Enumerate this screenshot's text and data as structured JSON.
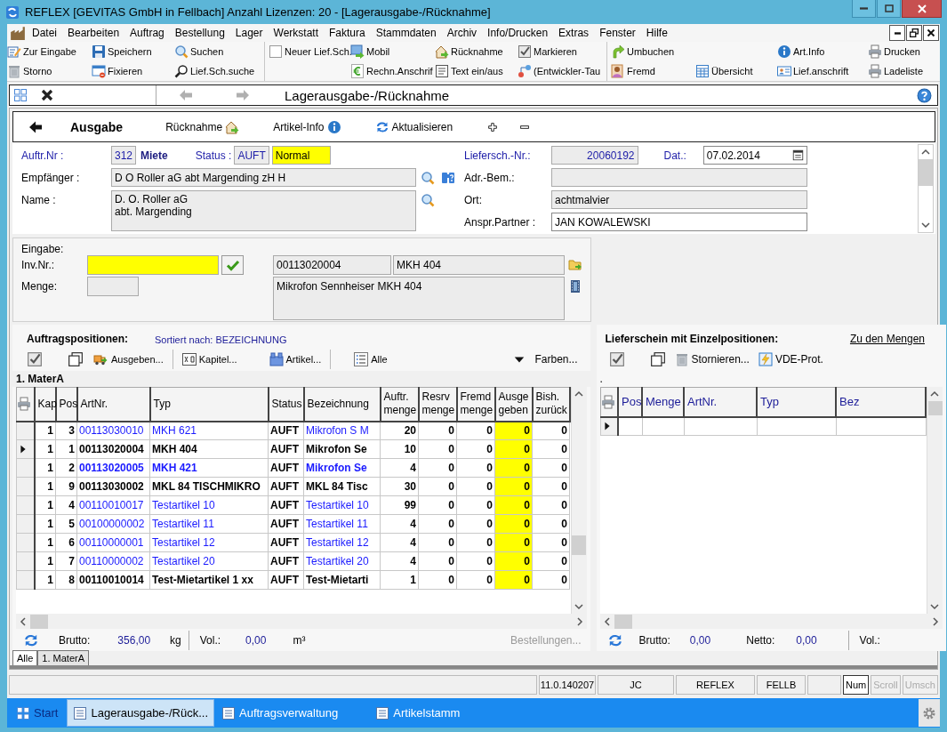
{
  "window": {
    "title": "REFLEX [GEVITAS GmbH in Fellbach] Anzahl Lizenzen: 20 - [Lagerausgabe-/Rücknahme]"
  },
  "menu": [
    "Datei",
    "Bearbeiten",
    "Auftrag",
    "Bestellung",
    "Lager",
    "Werkstatt",
    "Faktura",
    "Stammdaten",
    "Archiv",
    "Info/Drucken",
    "Extras",
    "Fenster",
    "Hilfe"
  ],
  "toolbar": {
    "groups": [
      {
        "columns": [
          {
            "top": "Zur Eingabe",
            "bottom": "Storno"
          },
          {
            "top": "Speichern",
            "bottom": "Fixieren"
          },
          {
            "top": "Suchen",
            "bottom": "Lief.Sch.suche"
          }
        ]
      },
      {
        "columns": [
          {
            "top": "Neuer Lief.Sch."
          },
          {
            "top": "Mobil",
            "bottom": "Rechn.Anschrif"
          },
          {
            "top": "Rücknahme",
            "bottom": "Text ein/aus"
          },
          {
            "top": "Markieren",
            "bottom": "(Entwickler-Tau"
          }
        ]
      },
      {
        "columns": [
          {
            "top": "Umbuchen",
            "bottom": "Fremd"
          },
          {
            "bottom": "Übersicht"
          },
          {
            "top": "Art.Info",
            "bottom": "Lief.anschrift"
          },
          {
            "top": "Drucken",
            "bottom": "Ladeliste"
          }
        ]
      }
    ]
  },
  "document_tab": {
    "title": "Lagerausgabe-/Rücknahme",
    "back": {
      "disabled": true
    },
    "forward": {
      "disabled": true
    }
  },
  "actions": {
    "mode": "Ausgabe",
    "items": [
      "Rücknahme",
      "Artikel-Info",
      "Aktualisieren"
    ]
  },
  "header": {
    "auftr_nr": {
      "label": "Auftr.Nr :",
      "value": {
        "text": "312",
        "color": "#1c1ca8"
      },
      "color": "#1c1ca8",
      "editable": false
    },
    "auftrag_art": "Miete",
    "status": {
      "label": "Status :",
      "value": {
        "text": "AUFT",
        "color": "#1c1ca8"
      },
      "color": "#1c1ca8",
      "editable": false
    },
    "priority": {
      "value": "Normal",
      "highlighted": true
    },
    "empfaenger": {
      "label": "Empfänger :",
      "value": "D O Roller aG abt Margending zH H",
      "color": "#000000",
      "editable": false
    },
    "name": {
      "label": "Name :",
      "value": "D. O. Roller aG\nabt. Margending",
      "color": "#000000",
      "editable": false
    },
    "lieferschein_nr": {
      "label": "Liefersch.-Nr.:",
      "value": {
        "text": "20060192",
        "color": "#1c1ca8"
      },
      "color": "#1c1ca8",
      "editable": false
    },
    "datum": {
      "label": "Dat.:",
      "value": "07.02.2014",
      "color": "#1c1ca8",
      "editable": true
    },
    "adr_bem": {
      "label": "Adr.-Bem.:",
      "color": "#000000",
      "editable": false
    },
    "ort": {
      "label": "Ort:",
      "value": "achtmalvier",
      "color": "#000000",
      "editable": false
    },
    "ansprechpartner": {
      "label": "Anspr.Partner :",
      "value": "JAN KOWALEWSKI",
      "color": "#000000",
      "editable": true
    }
  },
  "eingabe": {
    "title": "Eingabe:",
    "inv_nr": {
      "label": "Inv.Nr.:",
      "highlighted": true
    },
    "menge": {
      "label": "Menge:",
      "highlighted": false
    },
    "artikel_nr": "00113020004",
    "typ": "MKH 404",
    "beschreibung": "Mikrofon Sennheiser MKH 404"
  },
  "positions": {
    "title": "Auftragspositionen:",
    "sort": "Sortiert nach: BEZEICHNUNG",
    "tools": [
      "Ausgeben...",
      "Kapitel...",
      "Artikel...",
      "Alle"
    ],
    "colors_menu": "Farben...",
    "group": "1. MaterA",
    "columns": [
      {
        "label": "Kap",
        "highlighted": false
      },
      {
        "label": "Pos",
        "highlighted": false
      },
      {
        "label": "ArtNr.",
        "highlighted": false
      },
      {
        "label": "Typ",
        "highlighted": false
      },
      {
        "label": "Status",
        "highlighted": false
      },
      {
        "label": "Bezeichnung",
        "highlighted": false
      },
      {
        "label": "Auftr.\nmenge",
        "highlighted": false
      },
      {
        "label": "Resrv\nmenge",
        "highlighted": false
      },
      {
        "label": "Fremd\nmenge",
        "highlighted": false
      },
      {
        "label": "Ausge\ngeben",
        "highlighted": true
      },
      {
        "label": "Bish.\nzurück",
        "highlighted": false
      }
    ],
    "rows": [
      {
        "selected": false,
        "bold": false,
        "color": "#1a1aff",
        "cells": [
          "1",
          "3",
          "00113030010",
          "MKH 621",
          "AUFT",
          "Mikrofon S M",
          "20",
          "0",
          "0",
          "0",
          "0"
        ]
      },
      {
        "selected": true,
        "bold": true,
        "color": "#000000",
        "cells": [
          "1",
          "1",
          "00113020004",
          "MKH 404",
          "AUFT",
          "Mikrofon Se",
          "10",
          "0",
          "0",
          "0",
          "0"
        ]
      },
      {
        "selected": false,
        "bold": true,
        "color": "#1a1aff",
        "cells": [
          "1",
          "2",
          "00113020005",
          "MKH 421",
          "AUFT",
          "Mikrofon Se",
          "4",
          "0",
          "0",
          "0",
          "0"
        ]
      },
      {
        "selected": false,
        "bold": true,
        "color": "#000000",
        "cells": [
          "1",
          "9",
          "00113030002",
          "MKL 84 TISCHMIKRO",
          "AUFT",
          "MKL 84 Tisc",
          "30",
          "0",
          "0",
          "0",
          "0"
        ]
      },
      {
        "selected": false,
        "bold": false,
        "color": "#1a1aff",
        "cells": [
          "1",
          "4",
          "00110010017",
          "Testartikel 10",
          "AUFT",
          "Testartikel 10",
          "99",
          "0",
          "0",
          "0",
          "0"
        ]
      },
      {
        "selected": false,
        "bold": false,
        "color": "#1a1aff",
        "cells": [
          "1",
          "5",
          "00100000002",
          "Testartikel 11",
          "AUFT",
          "Testartikel 11",
          "4",
          "0",
          "0",
          "0",
          "0"
        ]
      },
      {
        "selected": false,
        "bold": false,
        "color": "#1a1aff",
        "cells": [
          "1",
          "6",
          "00110000001",
          "Testartikel 12",
          "AUFT",
          "Testartikel 12",
          "4",
          "0",
          "0",
          "0",
          "0"
        ]
      },
      {
        "selected": false,
        "bold": false,
        "color": "#1a1aff",
        "cells": [
          "1",
          "7",
          "00110000002",
          "Testartikel 20",
          "AUFT",
          "Testartikel 20",
          "4",
          "0",
          "0",
          "0",
          "0"
        ]
      },
      {
        "selected": false,
        "bold": true,
        "color": "#000000",
        "cells": [
          "1",
          "8",
          "00110010014",
          "Test-Mietartikel 1 xx",
          "AUFT",
          "Test-Mietarti",
          "1",
          "0",
          "0",
          "0",
          "0"
        ]
      }
    ],
    "footer": {
      "brutto_label": "Brutto:",
      "brutto": "356,00",
      "brutto_unit": "kg",
      "vol_label": "Vol.:",
      "vol": "0,00",
      "vol_unit": "m³",
      "orders": {
        "label": "Bestellungen...",
        "disabled": true
      }
    }
  },
  "delivery": {
    "title": "Lieferschein mit Einzelpositionen:",
    "link": "Zu den Mengen",
    "tools": [
      "Stornieren...",
      "VDE-Prot."
    ],
    "caption": ".",
    "columns": [
      "Pos",
      "Menge",
      "ArtNr.",
      "Typ",
      "Bez"
    ],
    "rows": [
      {
        "selected": true
      }
    ],
    "footer": {
      "brutto_label": "Brutto:",
      "brutto": "0,00",
      "netto_label": "Netto:",
      "netto": "0,00",
      "vol_label": "Vol.:"
    }
  },
  "bottom_tabs": [
    {
      "label": "Alle",
      "selected": true
    },
    {
      "label": "1. MaterA",
      "selected": false
    }
  ],
  "status_bar": {
    "panels": [
      "11.0.140207",
      "JC",
      "REFLEX",
      "FELLB"
    ],
    "keys": [
      {
        "label": "Num",
        "on": true
      },
      {
        "label": "Scroll",
        "on": false
      },
      {
        "label": "Umsch",
        "on": false
      }
    ]
  },
  "taskbar": {
    "start": "Start",
    "items": [
      {
        "label": "Lagerausgabe-/Rück...",
        "selected": true
      },
      {
        "label": "Auftragsverwaltung",
        "selected": false
      },
      {
        "label": "Artikelstamm",
        "selected": false
      }
    ]
  }
}
